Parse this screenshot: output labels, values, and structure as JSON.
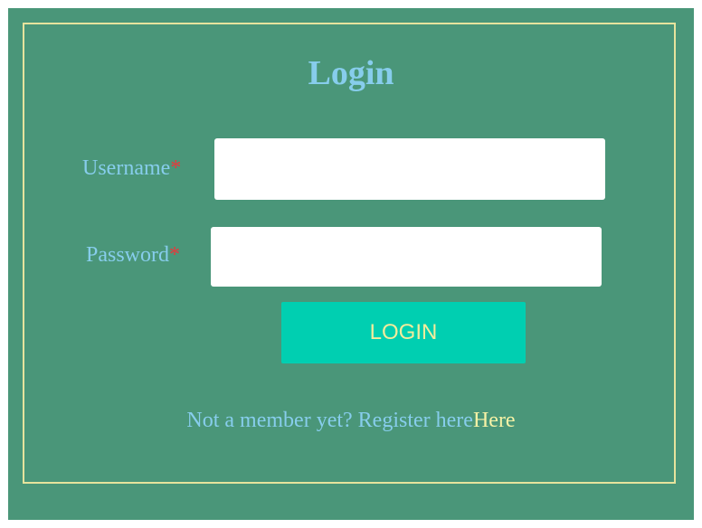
{
  "login_form": {
    "title": "Login",
    "username_label": "Username",
    "password_label": "Password",
    "required_marker": "*",
    "username_value": "",
    "password_value": "",
    "submit_label": "LOGIN",
    "register_prompt": "Not a member yet? Register here",
    "register_link": "Here"
  },
  "colors": {
    "panel_background": "#4a9679",
    "frame_border": "#e6e39d",
    "title_text": "#87cdec",
    "required_marker": "#e8383b",
    "button_background": "#00cfb1",
    "button_text": "#f3ec9c",
    "link_text": "#f7f2a6"
  }
}
